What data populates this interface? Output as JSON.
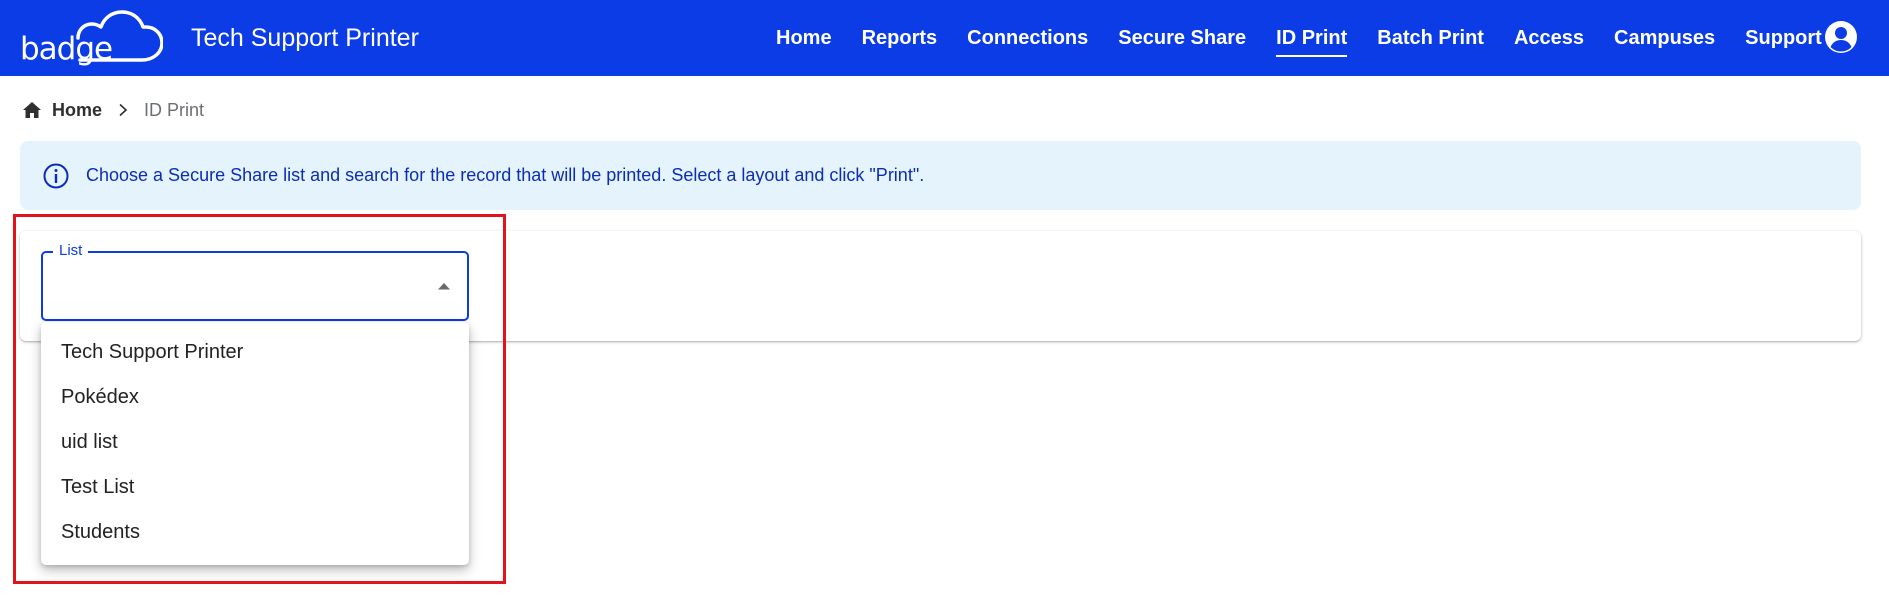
{
  "header": {
    "logo_text": "badge",
    "app_title": "Tech Support Printer",
    "nav": [
      {
        "label": "Home",
        "active": false
      },
      {
        "label": "Reports",
        "active": false
      },
      {
        "label": "Connections",
        "active": false
      },
      {
        "label": "Secure Share",
        "active": false
      },
      {
        "label": "ID Print",
        "active": true
      },
      {
        "label": "Batch Print",
        "active": false
      },
      {
        "label": "Access",
        "active": false
      },
      {
        "label": "Campuses",
        "active": false
      },
      {
        "label": "Support",
        "active": false
      }
    ],
    "account_icon": "account-circle-icon"
  },
  "breadcrumb": {
    "home_label": "Home",
    "current_label": "ID Print"
  },
  "alert": {
    "icon": "info-icon",
    "text": "Choose a Secure Share list and search for the record that will be printed. Select a layout and click \"Print\"."
  },
  "list_select": {
    "label": "List",
    "value": "",
    "arrow_icon": "caret-up-icon",
    "options": [
      "Tech Support Printer",
      "Pokédex",
      "uid list",
      "Test List",
      "Students"
    ]
  },
  "colors": {
    "brand_blue": "#0b3ce6",
    "alert_bg": "#e5f4fc",
    "alert_text": "#0b2db5",
    "highlight_red": "#e0141a"
  }
}
